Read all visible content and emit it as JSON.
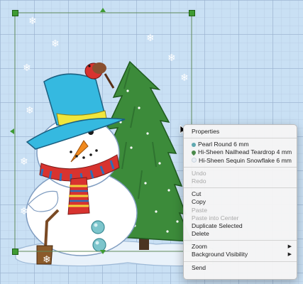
{
  "context_menu": {
    "properties": "Properties",
    "motifs": [
      {
        "label": "Pearl Round 6 mm",
        "icon": "pearl-round-icon",
        "color": "#5fa8b0"
      },
      {
        "label": "Hi-Sheen Nailhead Teardrop 4 mm",
        "icon": "teardrop-icon",
        "color": "#4a8a4a"
      },
      {
        "label": "Hi-Sheen Sequin Snowflake 6 mm",
        "icon": "snowflake-icon",
        "color": "#e8eef4"
      }
    ],
    "undo": "Undo",
    "redo": "Redo",
    "cut": "Cut",
    "copy": "Copy",
    "paste": "Paste",
    "paste_into_center": "Paste into Center",
    "duplicate_selected": "Duplicate Selected",
    "delete": "Delete",
    "zoom": "Zoom",
    "background_visibility": "Background Visibility",
    "send": "Send",
    "submenu_arrow": "▶"
  },
  "colors": {
    "selection_handle": "#3f9b33",
    "canvas_grid": "#96afcd",
    "canvas_background": "#c9e0f4"
  }
}
